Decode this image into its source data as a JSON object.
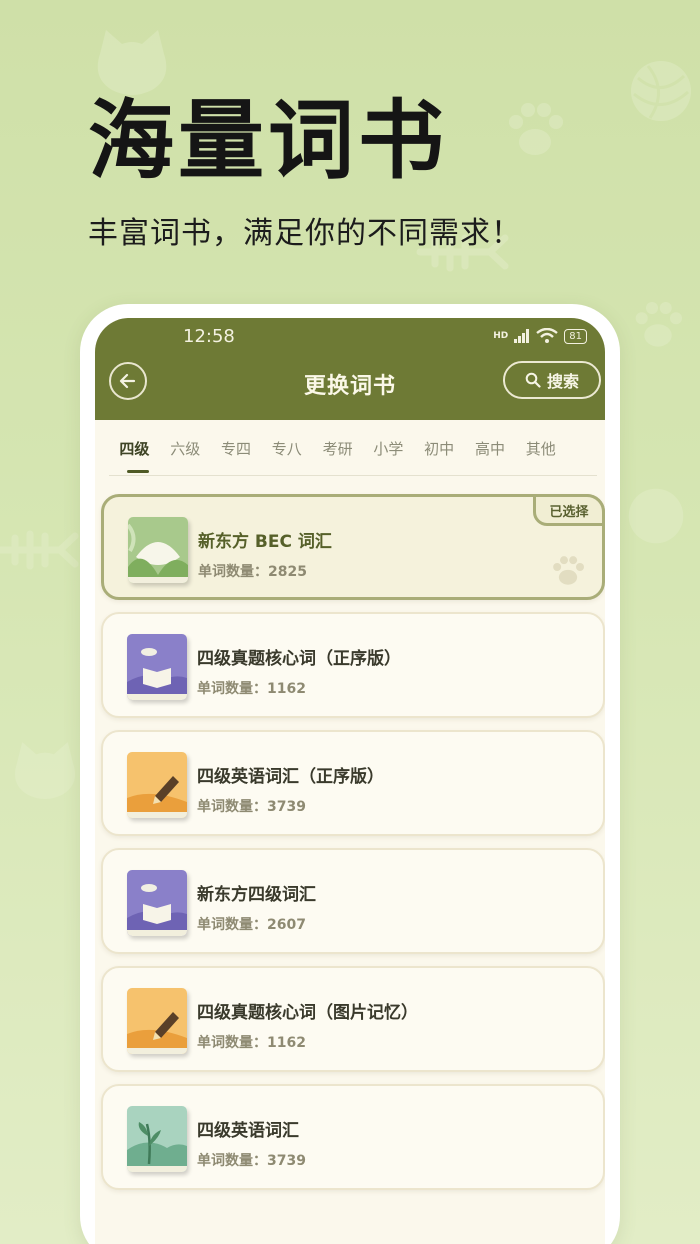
{
  "hero": {
    "title": "海量词书",
    "subtitle": "丰富词书，满足你的不同需求！"
  },
  "status": {
    "time": "12:58",
    "battery": "81",
    "network": "HD"
  },
  "appbar": {
    "title": "更换词书",
    "search_label": "搜索"
  },
  "tabs": [
    {
      "label": "四级",
      "active": true
    },
    {
      "label": "六级"
    },
    {
      "label": "专四"
    },
    {
      "label": "专八"
    },
    {
      "label": "考研"
    },
    {
      "label": "小学"
    },
    {
      "label": "初中"
    },
    {
      "label": "高中"
    },
    {
      "label": "其他"
    }
  ],
  "books": [
    {
      "name": "新东方 BEC 词汇",
      "count_label": "单词数量：",
      "count": "2825",
      "selected": true,
      "badge": "已选择",
      "cover": "green-book"
    },
    {
      "name": "四级真题核心词（正序版）",
      "count_label": "单词数量：",
      "count": "1162",
      "cover": "purple-book"
    },
    {
      "name": "四级英语词汇（正序版）",
      "count_label": "单词数量：",
      "count": "3739",
      "cover": "orange-book"
    },
    {
      "name": "新东方四级词汇",
      "count_label": "单词数量：",
      "count": "2607",
      "cover": "purple-book"
    },
    {
      "name": "四级真题核心词（图片记忆）",
      "count_label": "单词数量：",
      "count": "1162",
      "cover": "orange-book"
    },
    {
      "name": "四级英语词汇",
      "count_label": "单词数量：",
      "count": "3739",
      "cover": "plant-book"
    }
  ],
  "colors": {
    "appbar": "#6e7a35",
    "background": "#d6e6b3",
    "selected_border": "#a9ad78"
  }
}
